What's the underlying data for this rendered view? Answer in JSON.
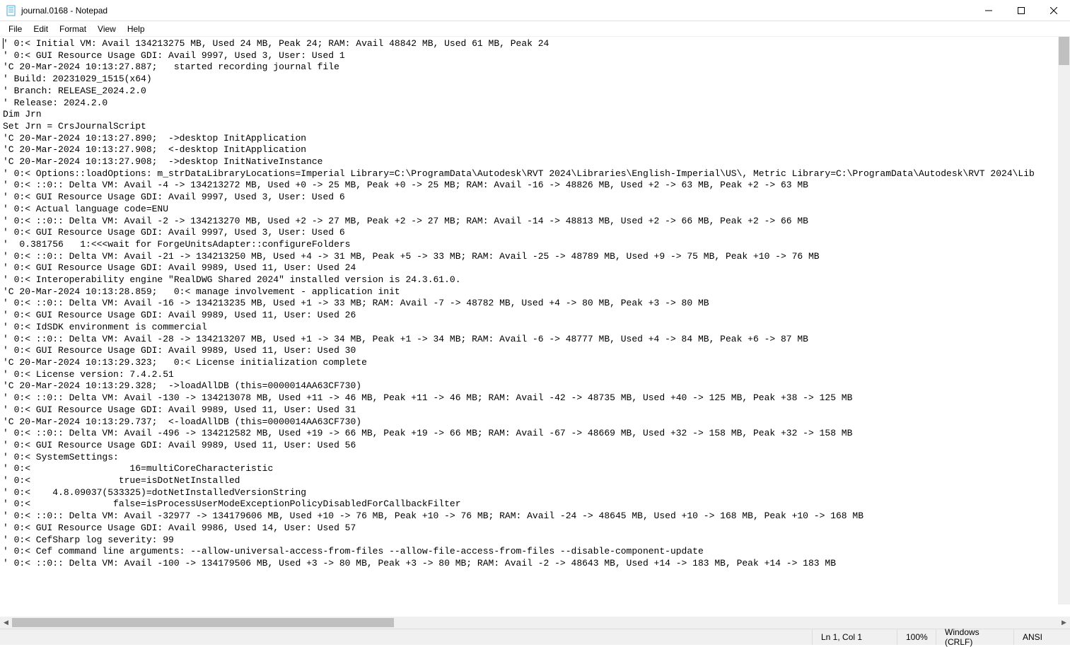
{
  "window": {
    "title": "journal.0168 - Notepad"
  },
  "menu": {
    "file": "File",
    "edit": "Edit",
    "format": "Format",
    "view": "View",
    "help": "Help"
  },
  "document": {
    "lines": [
      "' 0:< Initial VM: Avail 134213275 MB, Used 24 MB, Peak 24; RAM: Avail 48842 MB, Used 61 MB, Peak 24",
      "' 0:< GUI Resource Usage GDI: Avail 9997, Used 3, User: Used 1",
      "'C 20-Mar-2024 10:13:27.887;   started recording journal file",
      "' Build: 20231029_1515(x64)",
      "' Branch: RELEASE_2024.2.0",
      "' Release: 2024.2.0",
      "Dim Jrn",
      "Set Jrn = CrsJournalScript",
      "'C 20-Mar-2024 10:13:27.890;  ->desktop InitApplication",
      "'C 20-Mar-2024 10:13:27.908;  <-desktop InitApplication",
      "'C 20-Mar-2024 10:13:27.908;  ->desktop InitNativeInstance",
      "' 0:< Options::loadOptions: m_strDataLibraryLocations=Imperial Library=C:\\ProgramData\\Autodesk\\RVT 2024\\Libraries\\English-Imperial\\US\\, Metric Library=C:\\ProgramData\\Autodesk\\RVT 2024\\Lib",
      "' 0:< ::0:: Delta VM: Avail -4 -> 134213272 MB, Used +0 -> 25 MB, Peak +0 -> 25 MB; RAM: Avail -16 -> 48826 MB, Used +2 -> 63 MB, Peak +2 -> 63 MB",
      "' 0:< GUI Resource Usage GDI: Avail 9997, Used 3, User: Used 6",
      "' 0:< Actual language code=ENU",
      "' 0:< ::0:: Delta VM: Avail -2 -> 134213270 MB, Used +2 -> 27 MB, Peak +2 -> 27 MB; RAM: Avail -14 -> 48813 MB, Used +2 -> 66 MB, Peak +2 -> 66 MB",
      "' 0:< GUI Resource Usage GDI: Avail 9997, Used 3, User: Used 6",
      "'  0.381756   1:<<<wait for ForgeUnitsAdapter::configureFolders",
      "' 0:< ::0:: Delta VM: Avail -21 -> 134213250 MB, Used +4 -> 31 MB, Peak +5 -> 33 MB; RAM: Avail -25 -> 48789 MB, Used +9 -> 75 MB, Peak +10 -> 76 MB",
      "' 0:< GUI Resource Usage GDI: Avail 9989, Used 11, User: Used 24",
      "' 0:< Interoperability engine \"RealDWG Shared 2024\" installed version is 24.3.61.0.",
      "'C 20-Mar-2024 10:13:28.859;   0:< manage involvement - application init",
      "' 0:< ::0:: Delta VM: Avail -16 -> 134213235 MB, Used +1 -> 33 MB; RAM: Avail -7 -> 48782 MB, Used +4 -> 80 MB, Peak +3 -> 80 MB",
      "' 0:< GUI Resource Usage GDI: Avail 9989, Used 11, User: Used 26",
      "' 0:< IdSDK environment is commercial",
      "' 0:< ::0:: Delta VM: Avail -28 -> 134213207 MB, Used +1 -> 34 MB, Peak +1 -> 34 MB; RAM: Avail -6 -> 48777 MB, Used +4 -> 84 MB, Peak +6 -> 87 MB",
      "' 0:< GUI Resource Usage GDI: Avail 9989, Used 11, User: Used 30",
      "'C 20-Mar-2024 10:13:29.323;   0:< License initialization complete",
      "' 0:< License version: 7.4.2.51",
      "'C 20-Mar-2024 10:13:29.328;  ->loadAllDB (this=0000014AA63CF730)",
      "' 0:< ::0:: Delta VM: Avail -130 -> 134213078 MB, Used +11 -> 46 MB, Peak +11 -> 46 MB; RAM: Avail -42 -> 48735 MB, Used +40 -> 125 MB, Peak +38 -> 125 MB",
      "' 0:< GUI Resource Usage GDI: Avail 9989, Used 11, User: Used 31",
      "'C 20-Mar-2024 10:13:29.737;  <-loadAllDB (this=0000014AA63CF730)",
      "' 0:< ::0:: Delta VM: Avail -496 -> 134212582 MB, Used +19 -> 66 MB, Peak +19 -> 66 MB; RAM: Avail -67 -> 48669 MB, Used +32 -> 158 MB, Peak +32 -> 158 MB",
      "' 0:< GUI Resource Usage GDI: Avail 9989, Used 11, User: Used 56",
      "' 0:< SystemSettings:",
      "' 0:<                  16=multiCoreCharacteristic",
      "' 0:<                true=isDotNetInstalled",
      "' 0:<    4.8.09037(533325)=dotNetInstalledVersionString",
      "' 0:<               false=isProcessUserModeExceptionPolicyDisabledForCallbackFilter",
      "' 0:< ::0:: Delta VM: Avail -32977 -> 134179606 MB, Used +10 -> 76 MB, Peak +10 -> 76 MB; RAM: Avail -24 -> 48645 MB, Used +10 -> 168 MB, Peak +10 -> 168 MB",
      "' 0:< GUI Resource Usage GDI: Avail 9986, Used 14, User: Used 57",
      "' 0:< CefSharp log severity: 99",
      "' 0:< Cef command line arguments: --allow-universal-access-from-files --allow-file-access-from-files --disable-component-update",
      "' 0:< ::0:: Delta VM: Avail -100 -> 134179506 MB, Used +3 -> 80 MB, Peak +3 -> 80 MB; RAM: Avail -2 -> 48643 MB, Used +14 -> 183 MB, Peak +14 -> 183 MB"
    ]
  },
  "status": {
    "position": "Ln 1, Col 1",
    "zoom": "100%",
    "eol": "Windows (CRLF)",
    "encoding": "ANSI"
  }
}
